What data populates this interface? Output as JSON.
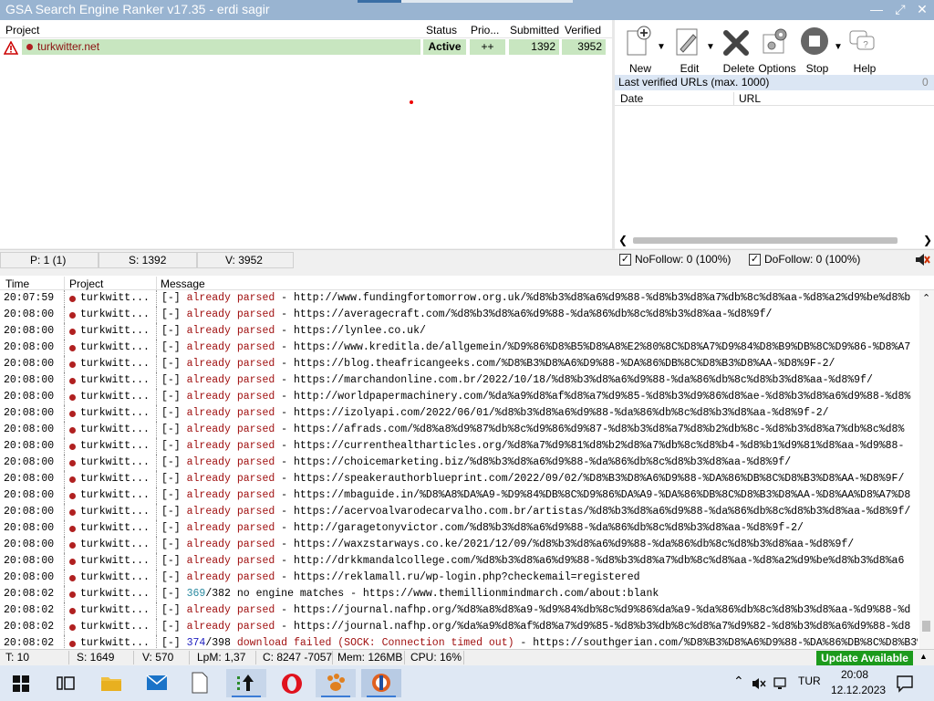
{
  "window": {
    "title": "GSA Search Engine Ranker v17.35 - erdi sagir",
    "controls": [
      "minimize",
      "restore",
      "close"
    ]
  },
  "projects": {
    "headers": {
      "project": "Project",
      "status": "Status",
      "priority": "Prio...",
      "submitted": "Submitted",
      "verified": "Verified"
    },
    "rows": [
      {
        "name": "turkwitter.net",
        "status": "Active",
        "priority": "++",
        "submitted": "1392",
        "verified": "3952",
        "warning_icon": "warning-triangle-icon"
      }
    ]
  },
  "toolbar": {
    "new": "New",
    "edit": "Edit",
    "delete": "Delete",
    "options": "Options",
    "stop": "Stop",
    "help": "Help"
  },
  "verified_urls": {
    "header": "Last verified URLs (max. 1000)",
    "count": "0",
    "col_date": "Date",
    "col_url": "URL"
  },
  "mid_status": {
    "projects": "P: 1 (1)",
    "submitted": "S: 1392",
    "verified": "V: 3952",
    "nofollow": "NoFollow: 0 (100%)",
    "dofollow": "DoFollow: 0 (100%)"
  },
  "log": {
    "headers": {
      "time": "Time",
      "project": "Project",
      "message": "Message"
    },
    "rows": [
      {
        "time": "20:07:59",
        "project": "turkwitt...",
        "tag": "[-]",
        "kind": "already parsed",
        "text": " - http://www.fundingfortomorrow.org.uk/%d8%b3%d8%a6%d9%88-%d8%b3%d8%a7%db%8c%d8%aa-%d8%a2%d9%be%d8%b"
      },
      {
        "time": "20:08:00",
        "project": "turkwitt...",
        "tag": "[-]",
        "kind": "already parsed",
        "text": " - https://averagecraft.com/%d8%b3%d8%a6%d9%88-%da%86%db%8c%d8%b3%d8%aa-%d8%9f/"
      },
      {
        "time": "20:08:00",
        "project": "turkwitt...",
        "tag": "[-]",
        "kind": "already parsed",
        "text": " - https://lynlee.co.uk/"
      },
      {
        "time": "20:08:00",
        "project": "turkwitt...",
        "tag": "[-]",
        "kind": "already parsed",
        "text": " - https://www.kreditla.de/allgemein/%D9%86%D8%B5%D8%A8%E2%80%8C%D8%A7%D9%84%D8%B9%DB%8C%D9%86-%D8%A7"
      },
      {
        "time": "20:08:00",
        "project": "turkwitt...",
        "tag": "[-]",
        "kind": "already parsed",
        "text": " - https://blog.theafricangeeks.com/%D8%B3%D8%A6%D9%88-%DA%86%DB%8C%D8%B3%D8%AA-%D8%9F-2/"
      },
      {
        "time": "20:08:00",
        "project": "turkwitt...",
        "tag": "[-]",
        "kind": "already parsed",
        "text": " - https://marchandonline.com.br/2022/10/18/%d8%b3%d8%a6%d9%88-%da%86%db%8c%d8%b3%d8%aa-%d8%9f/"
      },
      {
        "time": "20:08:00",
        "project": "turkwitt...",
        "tag": "[-]",
        "kind": "already parsed",
        "text": " - http://worldpapermachinery.com/%da%a9%d8%af%d8%a7%d9%85-%d8%b3%d9%86%d8%ae-%d8%b3%d8%a6%d9%88-%d8%"
      },
      {
        "time": "20:08:00",
        "project": "turkwitt...",
        "tag": "[-]",
        "kind": "already parsed",
        "text": " - https://izolyapi.com/2022/06/01/%d8%b3%d8%a6%d9%88-%da%86%db%8c%d8%b3%d8%aa-%d8%9f-2/"
      },
      {
        "time": "20:08:00",
        "project": "turkwitt...",
        "tag": "[-]",
        "kind": "already parsed",
        "text": " - https://afrads.com/%d8%a8%d9%87%db%8c%d9%86%d9%87-%d8%b3%d8%a7%d8%b2%db%8c-%d8%b3%d8%a7%db%8c%d8%"
      },
      {
        "time": "20:08:00",
        "project": "turkwitt...",
        "tag": "[-]",
        "kind": "already parsed",
        "text": " - https://currenthealtharticles.org/%d8%a7%d9%81%d8%b2%d8%a7%db%8c%d8%b4-%d8%b1%d9%81%d8%aa-%d9%88-"
      },
      {
        "time": "20:08:00",
        "project": "turkwitt...",
        "tag": "[-]",
        "kind": "already parsed",
        "text": " - https://choicemarketing.biz/%d8%b3%d8%a6%d9%88-%da%86%db%8c%d8%b3%d8%aa-%d8%9f/"
      },
      {
        "time": "20:08:00",
        "project": "turkwitt...",
        "tag": "[-]",
        "kind": "already parsed",
        "text": " - https://speakerauthorblueprint.com/2022/09/02/%D8%B3%D8%A6%D9%88-%DA%86%DB%8C%D8%B3%D8%AA-%D8%9F/"
      },
      {
        "time": "20:08:00",
        "project": "turkwitt...",
        "tag": "[-]",
        "kind": "already parsed",
        "text": " - https://mbaguide.in/%D8%A8%DA%A9-%D9%84%DB%8C%D9%86%DA%A9-%DA%86%DB%8C%D8%B3%D8%AA-%D8%AA%D8%A7%D8"
      },
      {
        "time": "20:08:00",
        "project": "turkwitt...",
        "tag": "[-]",
        "kind": "already parsed",
        "text": " - https://acervoalvarodecarvalho.com.br/artistas/%d8%b3%d8%a6%d9%88-%da%86%db%8c%d8%b3%d8%aa-%d8%9f/"
      },
      {
        "time": "20:08:00",
        "project": "turkwitt...",
        "tag": "[-]",
        "kind": "already parsed",
        "text": " - http://garagetonyvictor.com/%d8%b3%d8%a6%d9%88-%da%86%db%8c%d8%b3%d8%aa-%d8%9f-2/"
      },
      {
        "time": "20:08:00",
        "project": "turkwitt...",
        "tag": "[-]",
        "kind": "already parsed",
        "text": " - https://waxzstarways.co.ke/2021/12/09/%d8%b3%d8%a6%d9%88-%da%86%db%8c%d8%b3%d8%aa-%d8%9f/"
      },
      {
        "time": "20:08:00",
        "project": "turkwitt...",
        "tag": "[-]",
        "kind": "already parsed",
        "text": " - http://drkkmandalcollege.com/%d8%b3%d8%a6%d9%88-%d8%b3%d8%a7%db%8c%d8%aa-%d8%a2%d9%be%d8%b3%d8%a6"
      },
      {
        "time": "20:08:00",
        "project": "turkwitt...",
        "tag": "[-]",
        "kind": "already parsed",
        "text": " - https://reklamall.ru/wp-login.php?checkemail=registered"
      },
      {
        "time": "20:08:02",
        "project": "turkwitt...",
        "tag": "[-]",
        "num": "369",
        "den": "/382",
        "kind": "no engine matches",
        "text": " - https://www.themillionmindmarch.com/about:blank"
      },
      {
        "time": "20:08:02",
        "project": "turkwitt...",
        "tag": "[-]",
        "kind": "already parsed",
        "text": " - https://journal.nafhp.org/%d8%a8%d8%a9-%d9%84%db%8c%d9%86%da%a9-%da%86%db%8c%d8%b3%d8%aa-%d9%88-%d"
      },
      {
        "time": "20:08:02",
        "project": "turkwitt...",
        "tag": "[-]",
        "kind": "already parsed",
        "text": " - https://journal.nafhp.org/%da%a9%d8%af%d8%a7%d9%85-%d8%b3%db%8c%d8%a7%d9%82-%d8%b3%d8%a6%d9%88-%d8"
      },
      {
        "time": "20:08:02",
        "project": "turkwitt...",
        "tag": "[-]",
        "num": "374",
        "den": "/398",
        "kind": "download failed (SOCK: Connection timed out)",
        "text": " - https://southgerian.com/%D8%B3%D8%A6%D9%88-%DA%86%DB%8C%D8%B3%D8%AA-%D8"
      }
    ]
  },
  "bottom_status": {
    "threads": "T: 10",
    "submitted": "S: 1649",
    "verified": "V: 570",
    "lpm": "LpM: 1,37",
    "captcha": "C: 8247 -7057",
    "memory": "Mem: 126MB",
    "cpu": "CPU: 16%",
    "update": "Update Available"
  },
  "taskbar": {
    "language": "TUR",
    "time": "20:08",
    "date": "12.12.2023"
  }
}
